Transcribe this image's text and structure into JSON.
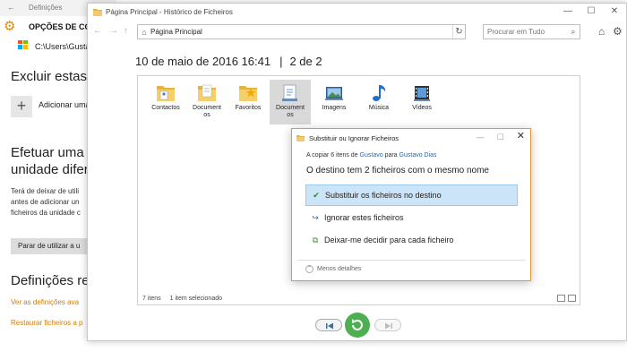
{
  "settings": {
    "title": "Definições",
    "back_glyph": "←",
    "section_title": "OPÇÕES DE CÓ",
    "path": "C:\\Users\\Gusta",
    "exclude_heading": "Excluir estas p",
    "add_label": "Adicionar uma",
    "backup_heading_1": "Efetuar uma c",
    "backup_heading_2": "unidade difere",
    "para_1": "Terá de deixar de utili",
    "para_2": "antes de adicionar un",
    "para_3": "ficheiros da unidade c",
    "stop_button": "Parar de utilizar a u",
    "related_heading": "Definições rela",
    "link_1": "Ver as definições ava",
    "link_2": "Restaurar ficheiros a p",
    "colors": {
      "accent": "#d17a00",
      "gear": "#e08a00"
    }
  },
  "file_history": {
    "window_title": "Página Principal - Histórico de Ficheiros",
    "window_controls": {
      "minimize": "—",
      "maximize": "☐",
      "close": "✕"
    },
    "nav": {
      "back": "←",
      "forward": "→",
      "up": "↑"
    },
    "address": "Página Principal",
    "search_placeholder": "Procurar em Tudo",
    "date": "10 de maio de 2016 16:41",
    "separator": "|",
    "page_indicator": "2 de 2",
    "items": [
      {
        "label_1": "Contactos",
        "label_2": "",
        "icon": "contacts-folder-icon",
        "selected": false
      },
      {
        "label_1": "Document",
        "label_2": "os",
        "icon": "documents-folder-icon",
        "selected": false
      },
      {
        "label_1": "Favoritos",
        "label_2": "",
        "icon": "favorites-folder-icon",
        "selected": false
      },
      {
        "label_1": "Document",
        "label_2": "os",
        "icon": "documents-library-icon",
        "selected": true
      },
      {
        "label_1": "Imagens",
        "label_2": "",
        "icon": "pictures-library-icon",
        "selected": false
      },
      {
        "label_1": "Música",
        "label_2": "",
        "icon": "music-library-icon",
        "selected": false
      },
      {
        "label_1": "Vídeos",
        "label_2": "",
        "icon": "videos-library-icon",
        "selected": false
      }
    ],
    "status_count": "7 itens",
    "status_selected": "1 item selecionado",
    "colors": {
      "restore": "#4caf50",
      "selected_item": "#d9d9d9"
    }
  },
  "dialog": {
    "title": "Substituir ou Ignorar Ficheiros",
    "controls": {
      "minimize": "—",
      "maximize": "☐",
      "close": "✕"
    },
    "copy_prefix": "A copiar 6 itens de ",
    "copy_from": "Gustavo",
    "copy_mid": " para ",
    "copy_to": "Gustavo Dias",
    "heading": "O destino tem 2 ficheiros com o mesmo nome",
    "option_replace": "Substituir os ficheiros no destino",
    "option_skip": "Ignorar estes ficheiros",
    "option_decide": "Deixar-me decidir para cada ficheiro",
    "details": "Menos detalhes",
    "colors": {
      "border": "#e39a2c",
      "highlight": "#cce4f7",
      "link": "#2767b0"
    }
  }
}
